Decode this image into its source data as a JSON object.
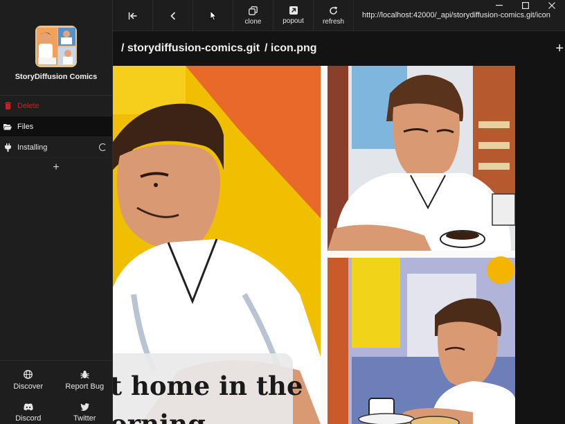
{
  "app": {
    "title": "StoryDiffusion Comics"
  },
  "sidebar": {
    "items": [
      {
        "label": "Delete",
        "icon": "trash-icon"
      },
      {
        "label": "Files",
        "icon": "folder-open-icon"
      },
      {
        "label": "Installing",
        "icon": "plug-icon"
      }
    ],
    "add_label": "+",
    "footer": [
      {
        "label": "Discover",
        "icon": "globe-icon"
      },
      {
        "label": "Report Bug",
        "icon": "bug-icon"
      },
      {
        "label": "Discord",
        "icon": "discord-icon"
      },
      {
        "label": "Twitter",
        "icon": "twitter-icon"
      }
    ]
  },
  "toolbar": {
    "clone_label": "clone",
    "popout_label": "popout",
    "refresh_label": "refresh",
    "url": "http://localhost:42000/_api/storydiffusion-comics.git/icon"
  },
  "path": {
    "repo": "/ storydiffusion-comics.git",
    "file": "/ icon.png",
    "add": "+"
  },
  "comic": {
    "caption_line1": "t home in the",
    "caption_line2": "orning"
  },
  "colors": {
    "danger": "#c02424",
    "active_bg": "#0f0f0f",
    "sidebar_bg": "#1e1e1f"
  }
}
